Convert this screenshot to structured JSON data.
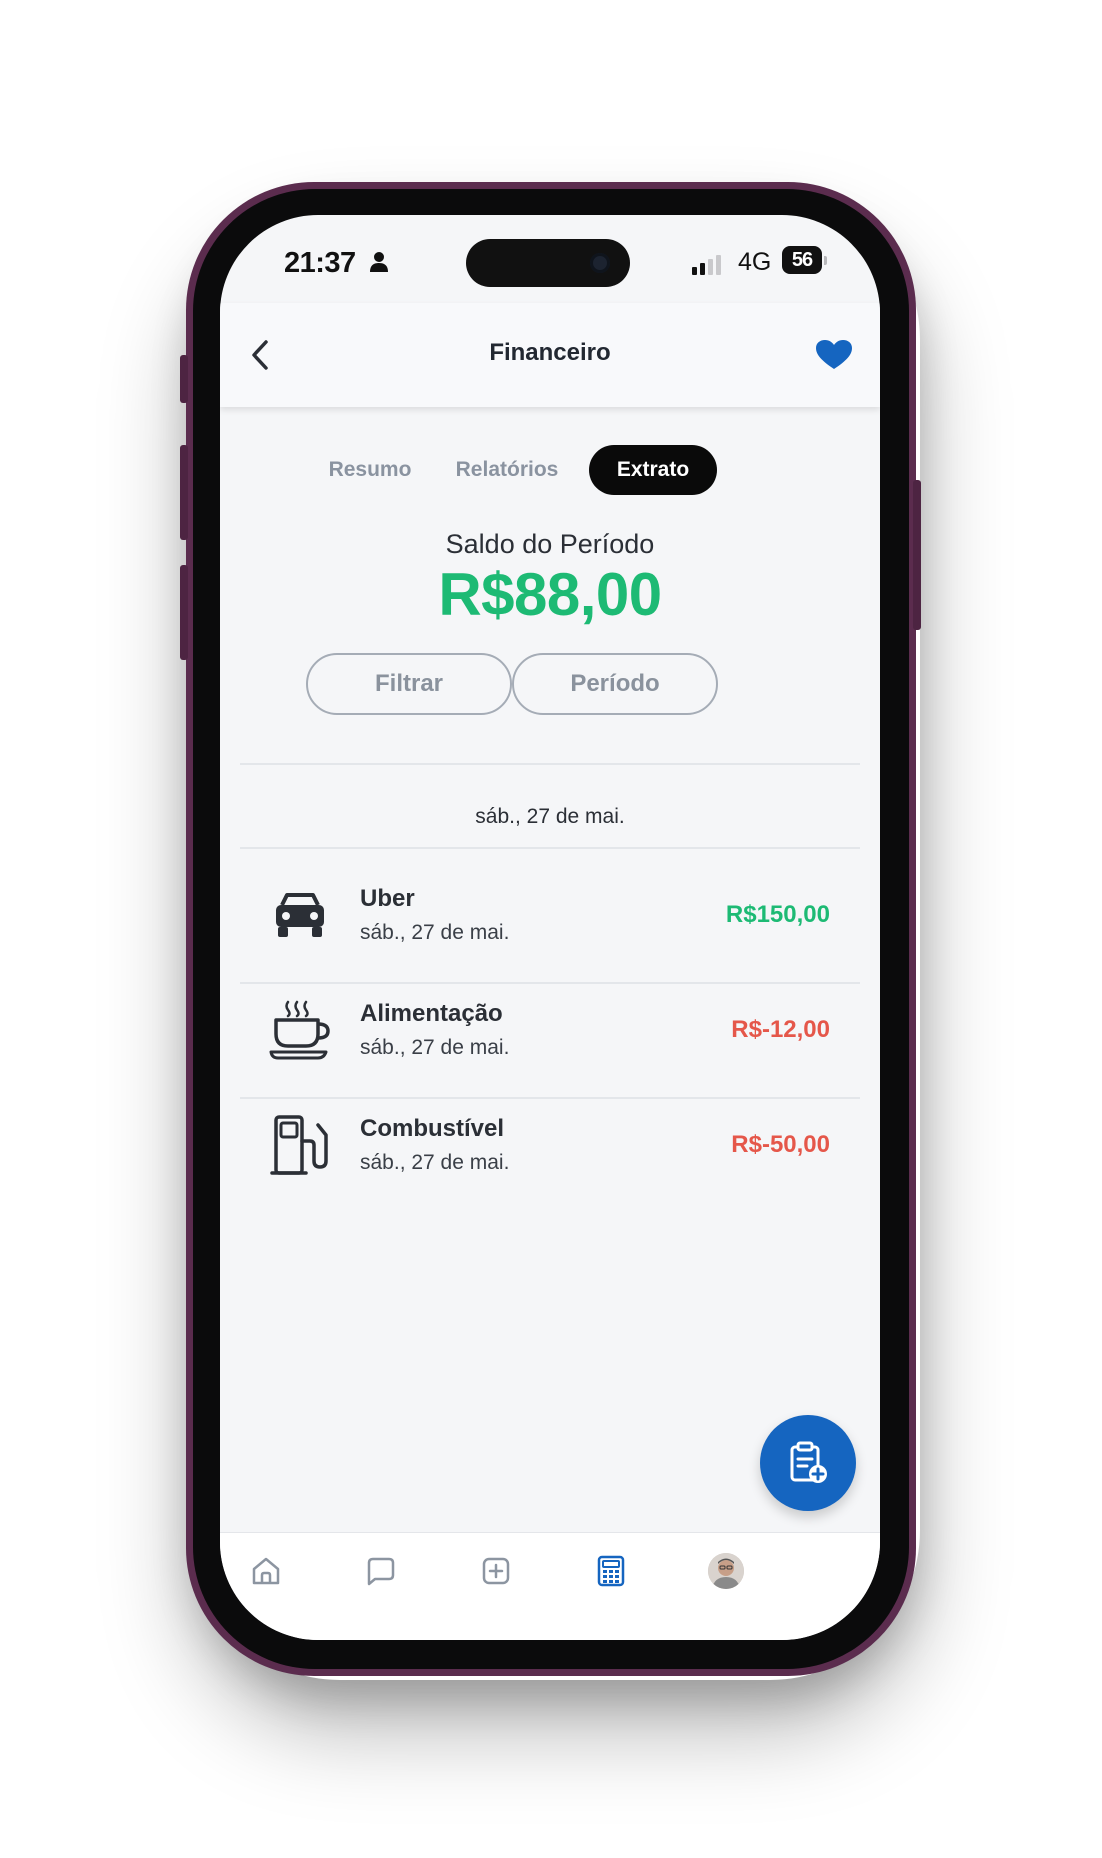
{
  "status_bar": {
    "time": "21:37",
    "network": "4G",
    "battery": "56",
    "icons": [
      "person-icon",
      "signal-bars-icon",
      "battery-icon"
    ]
  },
  "header": {
    "title": "Financeiro",
    "back_icon": "chevron-left-icon",
    "favorite_icon": "heart-icon"
  },
  "tabs": [
    {
      "label": "Resumo",
      "active": false
    },
    {
      "label": "Relatórios",
      "active": false
    },
    {
      "label": "Extrato",
      "active": true
    }
  ],
  "balance": {
    "label": "Saldo do Período",
    "value": "R$88,00"
  },
  "filters": {
    "filter_label": "Filtrar",
    "period_label": "Período"
  },
  "date_group": "sáb., 27 de mai.",
  "transactions": [
    {
      "title": "Uber",
      "date": "sáb., 27 de mai.",
      "amount": "R$150,00",
      "type": "income",
      "icon": "car-icon"
    },
    {
      "title": "Alimentação",
      "date": "sáb., 27 de mai.",
      "amount": "R$-12,00",
      "type": "expense",
      "icon": "coffee-cup-icon"
    },
    {
      "title": "Combustível",
      "date": "sáb., 27 de mai.",
      "amount": "R$-50,00",
      "type": "expense",
      "icon": "fuel-pump-icon"
    }
  ],
  "fab": {
    "icon": "clipboard-add-icon"
  },
  "tabbar": [
    {
      "icon": "home-icon",
      "active": false
    },
    {
      "icon": "chat-icon",
      "active": false
    },
    {
      "icon": "plus-square-icon",
      "active": false
    },
    {
      "icon": "calculator-icon",
      "active": true
    },
    {
      "icon": "avatar",
      "active": false
    }
  ],
  "colors": {
    "income": "#1dba74",
    "expense": "#e5574a",
    "accent": "#1565c0",
    "active_tab_bg": "#0a0a0a",
    "frame": "#5b2c4e"
  }
}
